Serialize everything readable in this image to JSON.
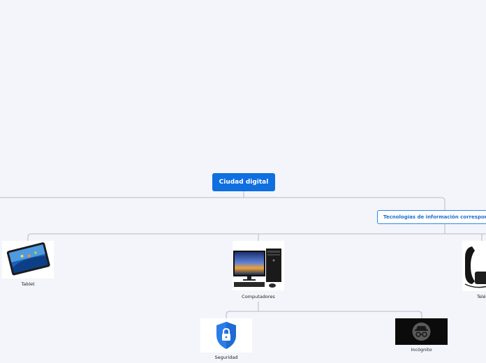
{
  "map": {
    "root": {
      "label": "Ciudad digital"
    },
    "subtopic": {
      "label": "Tecnologías de información correspondientes"
    },
    "devices": [
      {
        "label": "Tablet",
        "icon": "tablet-icon"
      },
      {
        "label": "Computadores",
        "icon": "desktop-computer-icon"
      },
      {
        "label": "Teléfono",
        "icon": "telephone-icon"
      }
    ],
    "computer_children": [
      {
        "label": "Seguridad",
        "icon": "lock-shield-icon"
      },
      {
        "label": "Incógnito",
        "icon": "incognito-icon"
      }
    ]
  },
  "colors": {
    "background": "#f3f5fb",
    "root_fill": "#0f6fe0",
    "subtopic_border": "#2f86e6",
    "connector": "#b7bcc6"
  }
}
